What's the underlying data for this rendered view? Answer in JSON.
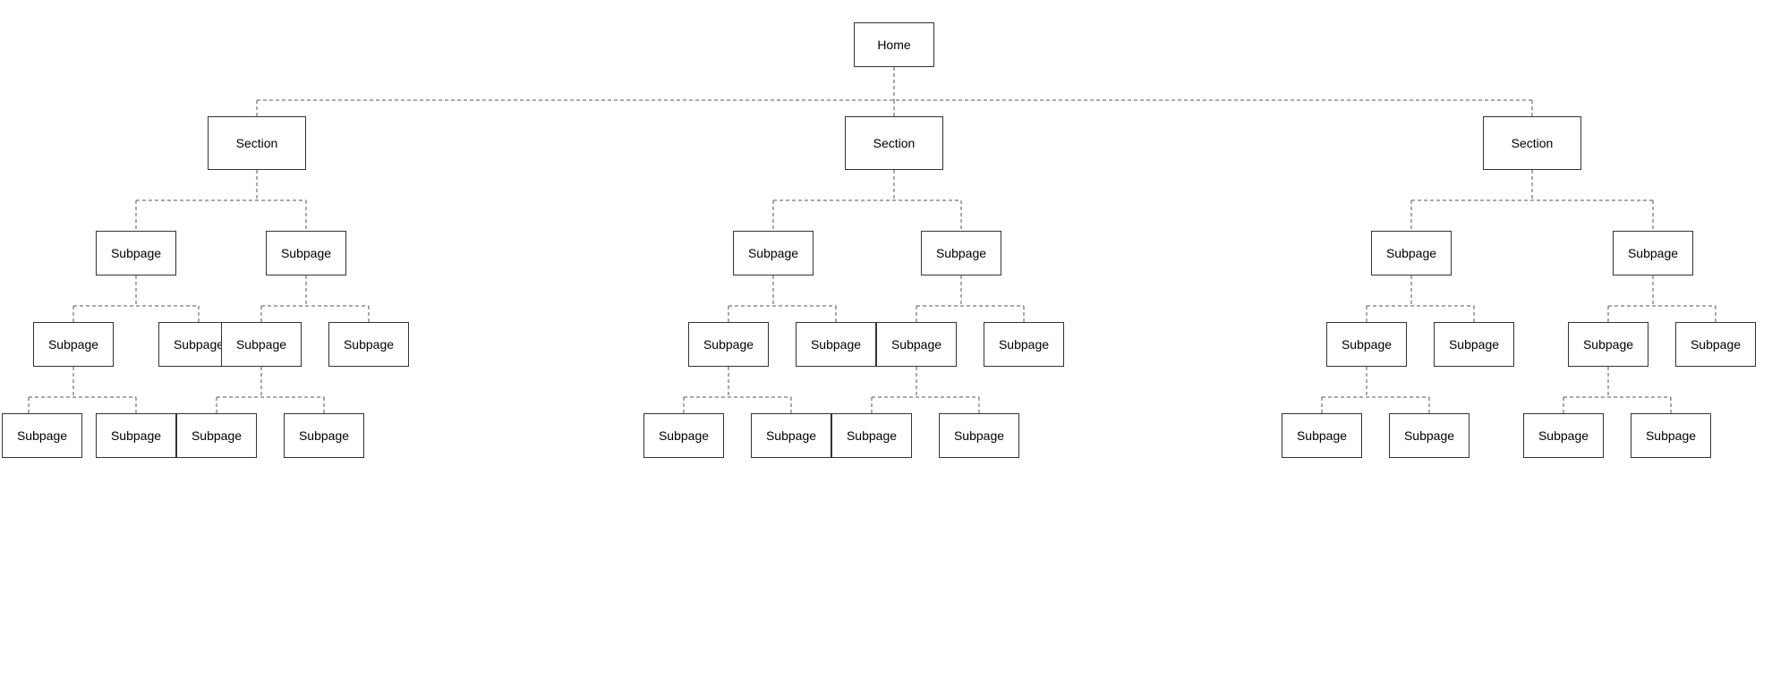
{
  "labels": {
    "home": "Home",
    "section": "Section",
    "subpage": "Subpage"
  },
  "colors": {
    "border": "#333",
    "connector": "#555"
  }
}
